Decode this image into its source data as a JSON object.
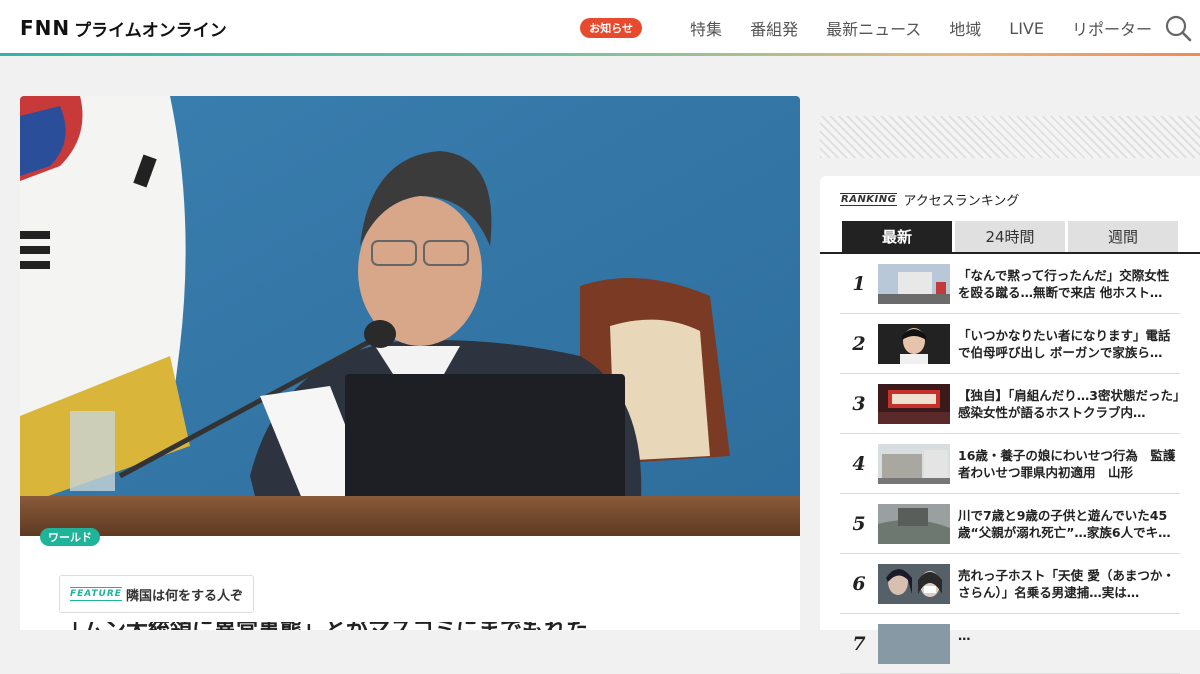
{
  "header": {
    "logo_fnn": "FNN",
    "logo_jp": "プライムオンライン",
    "badge": "お知らせ",
    "nav": [
      "特集",
      "番組発",
      "最新ニュース",
      "地域",
      "LIVE",
      "リポーター"
    ],
    "search_icon": "search-icon"
  },
  "article": {
    "category": "ワールド",
    "feature_tag": "FEATURE",
    "feature_title": "隣国は何をする人ぞ",
    "title_partial": "「ムン大統領に異常事態」とがマスコミにまでもれた"
  },
  "ranking": {
    "tag": "RANKING",
    "title": "アクセスランキング",
    "tabs": [
      "最新",
      "24時間",
      "週間"
    ],
    "active_tab": "最新",
    "items": [
      {
        "rank": "1",
        "text": "「なんで黙って行ったんだ」交際女性を殴る蹴る…無断で来店 他ホスト…"
      },
      {
        "rank": "2",
        "text": "「いつかなりたい者になります」電話で伯母呼び出し ボーガンで家族ら…"
      },
      {
        "rank": "3",
        "text": "【独自】「肩組んだり…3密状態だった」感染女性が語るホストクラブ内…"
      },
      {
        "rank": "4",
        "text": "16歳・養子の娘にわいせつ行為　監護者わいせつ罪県内初適用　山形"
      },
      {
        "rank": "5",
        "text": "川で7歳と9歳の子供と遊んでいた45歳“父親が溺れ死亡”…家族6人でキ…"
      },
      {
        "rank": "6",
        "text": "売れっ子ホスト「天使 愛（あまつか・さらん）」名乗る男逮捕…実は…"
      },
      {
        "rank": "7",
        "text": "…"
      }
    ]
  },
  "colors": {
    "accent_green": "#1fb49a",
    "badge_red": "#e84a2e",
    "tab_active": "#222222"
  }
}
